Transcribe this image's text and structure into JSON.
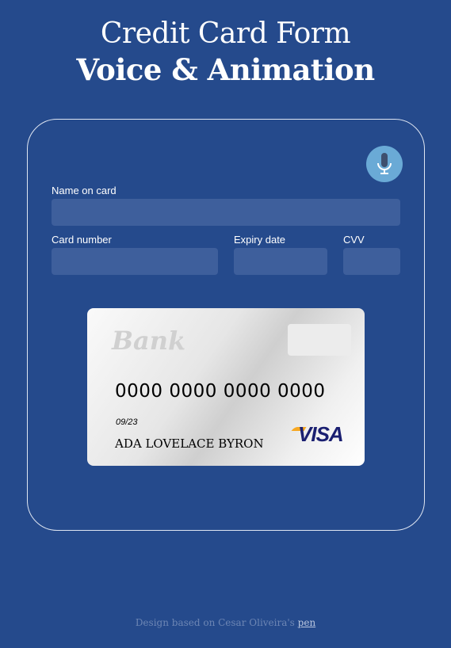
{
  "header": {
    "title_light": "Credit Card Form",
    "title_bold": "Voice & Animation"
  },
  "form": {
    "mic_icon": "microphone-icon",
    "name_label": "Name on card",
    "name_value": "",
    "number_label": "Card number",
    "number_value": "",
    "expiry_label": "Expiry date",
    "expiry_value": "",
    "cvv_label": "CVV",
    "cvv_value": ""
  },
  "card": {
    "bank": "Bank",
    "number": "0000 0000 0000 0000",
    "expiry": "09/23",
    "holder": "ADA LOVELACE BYRON",
    "brand": "VISA"
  },
  "footer": {
    "text": "Design based on Cesar Oliveira's ",
    "link": "pen"
  }
}
